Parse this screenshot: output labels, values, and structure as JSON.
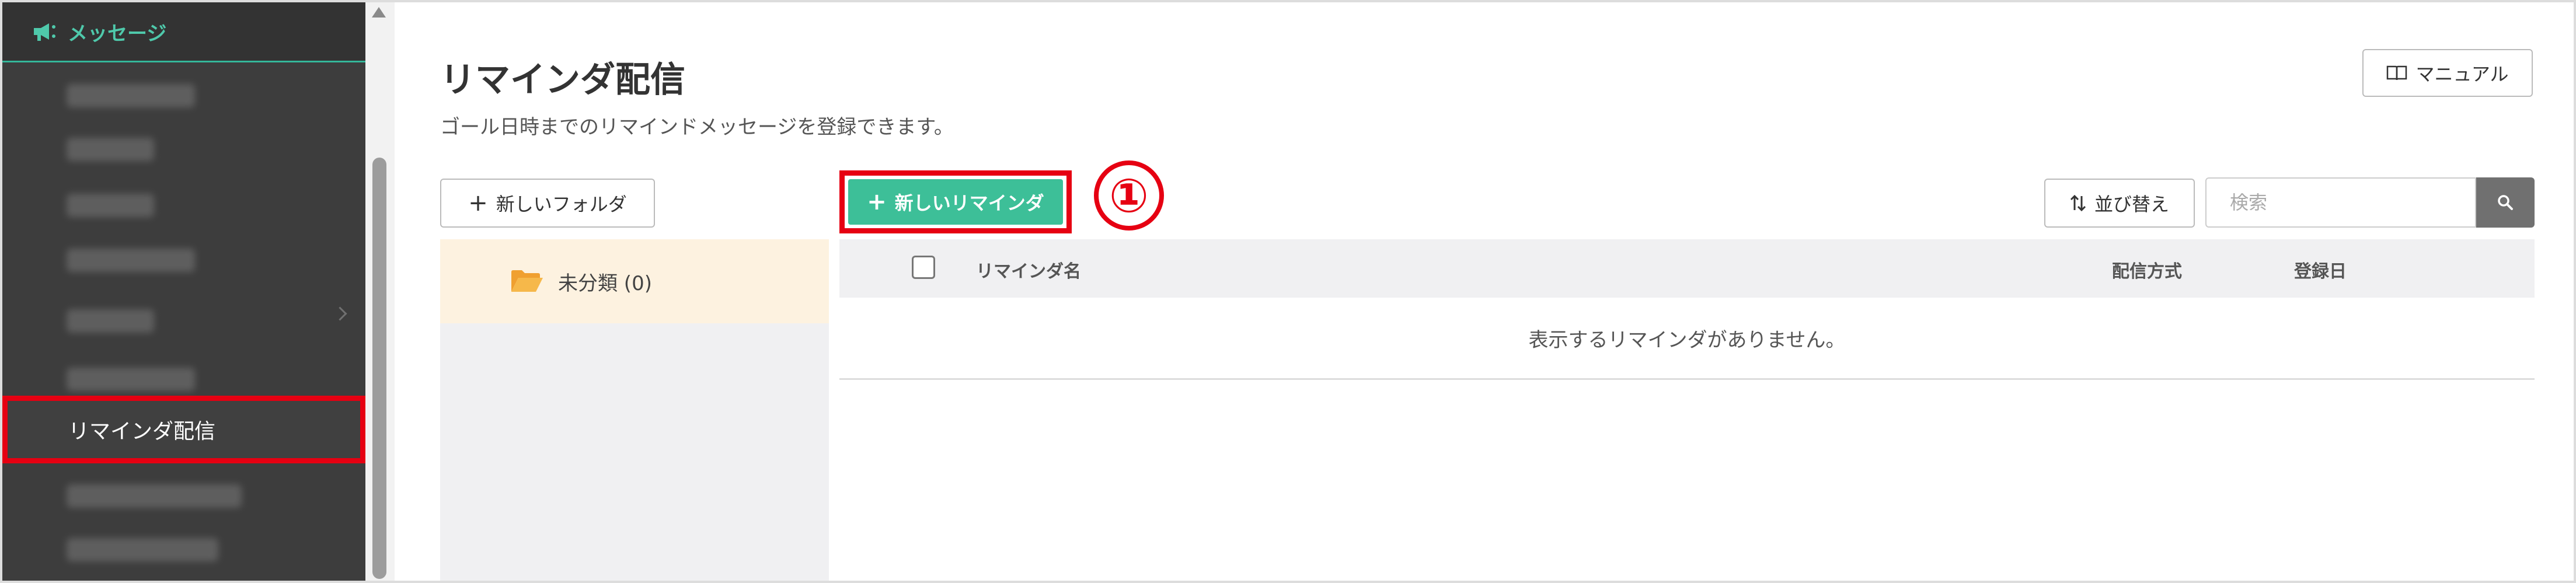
{
  "sidebar": {
    "section_title": "メッセージ",
    "active_item": "リマインダ配信"
  },
  "page": {
    "title": "リマインダ配信",
    "description": "ゴール日時までのリマインドメッセージを登録できます。"
  },
  "toolbar": {
    "manual_label": "マニュアル",
    "new_folder_label": "新しいフォルダ",
    "new_reminder_label": "新しいリマインダ",
    "sort_label": "並び替え",
    "search_placeholder": "検索"
  },
  "callout": {
    "number": "①"
  },
  "folders": [
    {
      "label": "未分類 (0)"
    }
  ],
  "table": {
    "columns": [
      "リマインダ名",
      "配信方式",
      "登録日"
    ],
    "empty_message": "表示するリマインダがありません。"
  },
  "colors": {
    "accent_green": "#3dbf98",
    "highlight_red": "#e60012",
    "sidebar_bg": "#3d3d3d",
    "folder_selected_bg": "#fdf2e0"
  }
}
